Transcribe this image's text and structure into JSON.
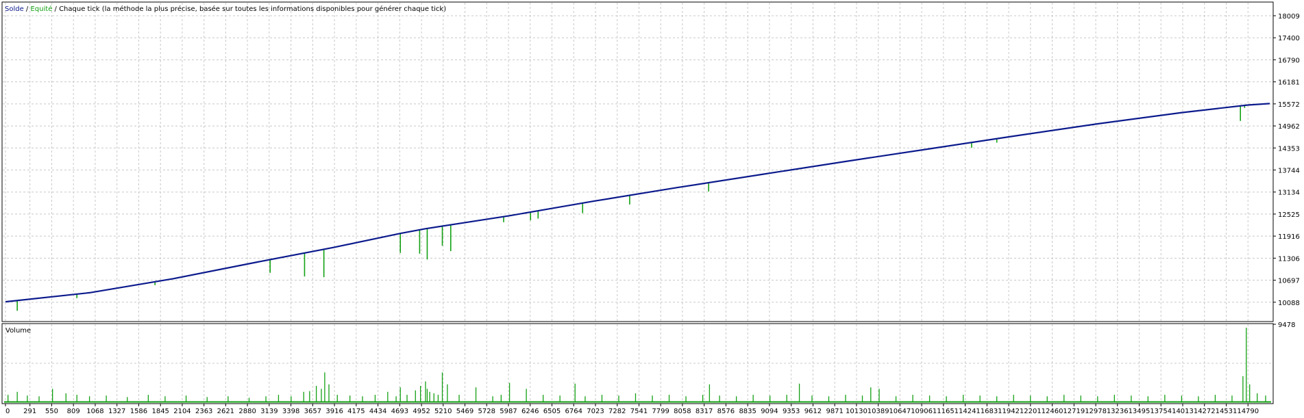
{
  "header": {
    "legend_balance": "Solde",
    "legend_sep1": " / ",
    "legend_equity": "Equité",
    "legend_sep2": " / ",
    "legend_model": "Chaque tick (la méthode la plus précise, basée sur toutes les informations disponibles pour générer chaque tick)"
  },
  "volume_panel": {
    "title": "Volume"
  },
  "colors": {
    "balance": "#0b1a8c",
    "equity": "#12a012",
    "volume": "#12a012",
    "grid": "#c8c8c8",
    "frame": "#000000"
  },
  "chart_data": [
    {
      "type": "line",
      "name": "balance-equity",
      "ylim": [
        9478,
        18009
      ],
      "xlim": [
        0,
        15049
      ],
      "y_ticks": [
        "18009",
        "17400",
        "16790",
        "16181",
        "15572",
        "14962",
        "14353",
        "13744",
        "13134",
        "12525",
        "11916",
        "11306",
        "10697",
        "10088",
        "9478"
      ],
      "x_ticks": [
        "0",
        "291",
        "550",
        "809",
        "1068",
        "1327",
        "1586",
        "1845",
        "2104",
        "2363",
        "2621",
        "2880",
        "3139",
        "3398",
        "3657",
        "3916",
        "4175",
        "4434",
        "4693",
        "4952",
        "5210",
        "5469",
        "5728",
        "5987",
        "6246",
        "6505",
        "6764",
        "7023",
        "7282",
        "7541",
        "7799",
        "8058",
        "8317",
        "8576",
        "8835",
        "9094",
        "9353",
        "9612",
        "9871",
        "10130",
        "10389",
        "10647",
        "10906",
        "11165",
        "11424",
        "11683",
        "11942",
        "12201",
        "12460",
        "12719",
        "12978",
        "13236",
        "13495",
        "13754",
        "14013",
        "14272",
        "14531",
        "14790"
      ],
      "series": [
        {
          "name": "Solde",
          "points": [
            [
              0,
              10100
            ],
            [
              1000,
              10350
            ],
            [
              2000,
              10740
            ],
            [
              3000,
              11200
            ],
            [
              3900,
              11600
            ],
            [
              4700,
              11990
            ],
            [
              5000,
              12120
            ],
            [
              5500,
              12300
            ],
            [
              6000,
              12480
            ],
            [
              6500,
              12680
            ],
            [
              7000,
              12880
            ],
            [
              8000,
              13260
            ],
            [
              9000,
              13620
            ],
            [
              10000,
              13980
            ],
            [
              11000,
              14330
            ],
            [
              12000,
              14680
            ],
            [
              13000,
              15020
            ],
            [
              14000,
              15330
            ],
            [
              14790,
              15540
            ],
            [
              15049,
              15580
            ]
          ]
        },
        {
          "name": "Equité",
          "drawdowns": [
            [
              140,
              9850
            ],
            [
              850,
              10200
            ],
            [
              1780,
              10560
            ],
            [
              3150,
              10900
            ],
            [
              3560,
              10800
            ],
            [
              3790,
              10780
            ],
            [
              4700,
              11450
            ],
            [
              4930,
              11430
            ],
            [
              5020,
              11270
            ],
            [
              5200,
              11650
            ],
            [
              5300,
              11500
            ],
            [
              5930,
              12300
            ],
            [
              6250,
              12350
            ],
            [
              6340,
              12400
            ],
            [
              6870,
              12550
            ],
            [
              7430,
              12790
            ],
            [
              8370,
              13150
            ],
            [
              10300,
              14080
            ],
            [
              11500,
              14360
            ],
            [
              11800,
              14500
            ],
            [
              14700,
              15100
            ],
            [
              14750,
              15460
            ]
          ]
        }
      ]
    },
    {
      "type": "bar",
      "name": "volume",
      "title": "Volume",
      "ylim": [
        0,
        100
      ],
      "x": [
        30,
        140,
        260,
        400,
        560,
        720,
        850,
        1000,
        1200,
        1450,
        1700,
        1900,
        2150,
        2400,
        2650,
        2900,
        3100,
        3250,
        3400,
        3550,
        3620,
        3700,
        3760,
        3800,
        3850,
        3950,
        4100,
        4250,
        4400,
        4550,
        4650,
        4700,
        4780,
        4880,
        4940,
        5000,
        5020,
        5050,
        5100,
        5150,
        5200,
        5260,
        5400,
        5600,
        5800,
        5900,
        6000,
        6200,
        6400,
        6600,
        6780,
        6900,
        7100,
        7300,
        7500,
        7700,
        7900,
        8100,
        8300,
        8380,
        8500,
        8700,
        8900,
        9100,
        9300,
        9450,
        9600,
        9800,
        10000,
        10200,
        10300,
        10400,
        10600,
        10800,
        11000,
        11200,
        11400,
        11600,
        11800,
        12000,
        12200,
        12400,
        12600,
        12800,
        13000,
        13200,
        13400,
        13600,
        13800,
        14000,
        14200,
        14400,
        14600,
        14730,
        14770,
        14810,
        14900,
        15000
      ],
      "values": [
        10,
        14,
        9,
        8,
        18,
        12,
        10,
        8,
        9,
        7,
        10,
        8,
        9,
        7,
        8,
        6,
        8,
        10,
        8,
        14,
        15,
        22,
        18,
        40,
        24,
        10,
        9,
        8,
        10,
        14,
        8,
        20,
        10,
        16,
        22,
        28,
        18,
        14,
        12,
        10,
        40,
        24,
        10,
        20,
        8,
        10,
        26,
        18,
        10,
        9,
        25,
        8,
        10,
        9,
        12,
        9,
        10,
        8,
        10,
        24,
        9,
        8,
        10,
        9,
        10,
        25,
        9,
        8,
        10,
        9,
        20,
        18,
        8,
        10,
        9,
        8,
        10,
        9,
        8,
        10,
        9,
        8,
        10,
        9,
        8,
        10,
        9,
        8,
        10,
        9,
        8,
        10,
        9,
        35,
        100,
        24,
        12,
        9
      ]
    }
  ]
}
